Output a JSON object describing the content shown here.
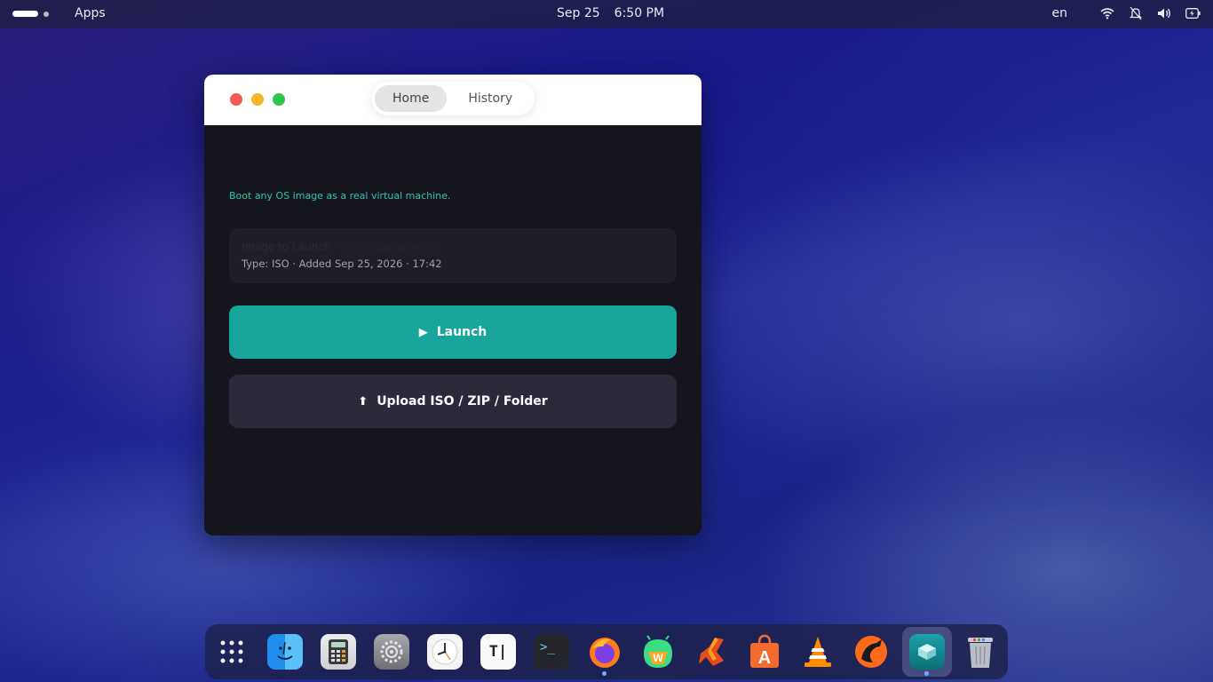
{
  "topbar": {
    "apps_label": "Apps",
    "date": "Sep 25",
    "time": "6:50 PM",
    "language": "en",
    "tray_icons": [
      "wifi-icon",
      "notifications-off-icon",
      "volume-icon",
      "battery-icon"
    ]
  },
  "window": {
    "tabs": [
      {
        "label": "Home",
        "active": true
      },
      {
        "label": "History",
        "active": false
      }
    ],
    "tagline": "Boot any OS image as a real virtual machine.",
    "image_card": {
      "name": "Image to Launch",
      "name_secondary": "· No image selected",
      "meta": "Type: ISO · Added Sep 25, 2026 · 17:42"
    },
    "launch_button": {
      "icon": "▶",
      "label": "Launch"
    },
    "upload_button": {
      "icon": "⬆",
      "label": "Upload ISO / ZIP / Folder"
    }
  },
  "dock": {
    "items": [
      {
        "name": "app-grid-icon"
      },
      {
        "name": "finder-icon"
      },
      {
        "name": "calculator-icon"
      },
      {
        "name": "settings-icon"
      },
      {
        "name": "clock-icon"
      },
      {
        "name": "text-editor-icon",
        "glyph": "T|"
      },
      {
        "name": "terminal-icon",
        "glyph": ">_"
      },
      {
        "name": "firefox-icon"
      },
      {
        "name": "waydroid-icon"
      },
      {
        "name": "runner-app-icon"
      },
      {
        "name": "app-store-icon"
      },
      {
        "name": "vlc-icon"
      },
      {
        "name": "fox-app-icon"
      },
      {
        "name": "vm-launcher-icon"
      },
      {
        "name": "trash-icon"
      }
    ]
  },
  "colors": {
    "accent": "#17a59c",
    "tagline": "#35c3ae",
    "upload_button": "#2c2a3a",
    "window_bg": "#15151e"
  }
}
